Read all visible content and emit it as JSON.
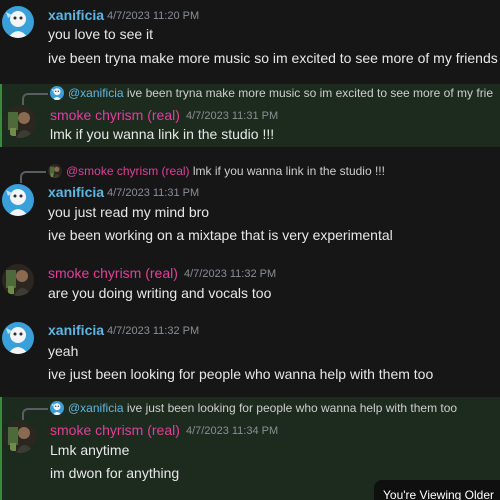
{
  "colors": {
    "xanificia": "#5fb6e3",
    "smoke": "#e0409a",
    "highlight_bg": "#1d2a1e",
    "highlight_border": "#3b8a43"
  },
  "messages": [
    {
      "author": "xanificia",
      "timestamp": "4/7/2023 11:20 PM",
      "lines": [
        "you love to see it",
        "ive been tryna make more music so im excited to see more of my friends"
      ]
    },
    {
      "reply": {
        "mention": "@xanificia",
        "text": "ive been tryna make more music so im excited to see more of my frie"
      },
      "author": "smoke chyrism (real)",
      "timestamp": "4/7/2023 11:31 PM",
      "lines": [
        "lmk if you wanna link in the studio !!!"
      ]
    },
    {
      "reply": {
        "mention": "@smoke chyrism (real)",
        "text": "lmk if you wanna link in the studio !!!"
      },
      "author": "xanificia",
      "timestamp": "4/7/2023 11:31 PM",
      "lines": [
        "you just read my mind bro",
        "ive been working on a mixtape that is very experimental"
      ]
    },
    {
      "author": "smoke chyrism (real)",
      "timestamp": "4/7/2023 11:32 PM",
      "lines": [
        "are you doing writing and vocals too"
      ]
    },
    {
      "author": "xanificia",
      "timestamp": "4/7/2023 11:32 PM",
      "lines": [
        "yeah",
        "ive just been looking for people who wanna help with them too"
      ]
    },
    {
      "reply": {
        "mention": "@xanificia",
        "text": "ive just been looking for people who wanna help with them too"
      },
      "author": "smoke chyrism (real)",
      "timestamp": "4/7/2023 11:34 PM",
      "lines": [
        "Lmk anytime",
        "im dwon for anything"
      ]
    }
  ],
  "banner": "You're Viewing Older"
}
